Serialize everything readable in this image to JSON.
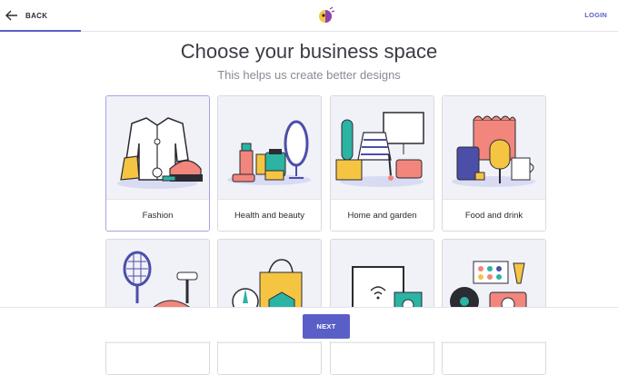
{
  "header": {
    "back_label": "BACK",
    "login_label": "LOGIN"
  },
  "main": {
    "title": "Choose your business space",
    "subtitle": "This helps us create better designs",
    "cards": [
      {
        "label": "Fashion",
        "selected": true
      },
      {
        "label": "Health and beauty",
        "selected": false
      },
      {
        "label": "Home and garden",
        "selected": false
      },
      {
        "label": "Food and drink",
        "selected": false
      },
      {
        "label": "",
        "selected": false
      },
      {
        "label": "",
        "selected": false
      },
      {
        "label": "",
        "selected": false
      },
      {
        "label": "",
        "selected": false
      }
    ]
  },
  "footer": {
    "next_label": "NEXT"
  },
  "colors": {
    "accent": "#5a5fc8",
    "card_bg": "#f1f1f8",
    "coral": "#f2867c",
    "teal": "#2bb3a3",
    "yellow": "#f5c542"
  }
}
